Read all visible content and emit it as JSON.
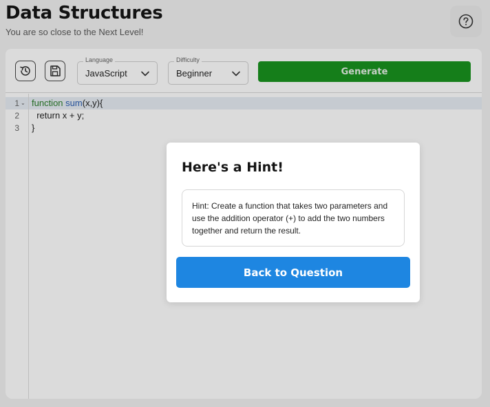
{
  "header": {
    "title": "Data Structures",
    "subtitle": "You are so close to the Next Level!"
  },
  "toolbar": {
    "history_icon": "history-icon",
    "save_icon": "save-icon",
    "language": {
      "legend": "Language",
      "value": "JavaScript"
    },
    "difficulty": {
      "legend": "Difficulty",
      "value": "Beginner"
    },
    "generate_label": "Generate"
  },
  "editor": {
    "lines": [
      {
        "num": "1"
      },
      {
        "num": "2",
        "text": "  return x + y;"
      },
      {
        "num": "3",
        "text": "}"
      }
    ],
    "line1": {
      "keyword": "function",
      "name": "sum",
      "rest": "(x,y){"
    }
  },
  "modal": {
    "title": "Here's a Hint!",
    "hint": "Hint: Create a function that takes two parameters and use the addition operator (+) to add the two numbers together and return the result.",
    "button_label": "Back to Question"
  },
  "colors": {
    "generate": "#19931f",
    "primary": "#1e86e1",
    "keyword": "#2a7d2a",
    "function_name": "#2b5fb3"
  }
}
